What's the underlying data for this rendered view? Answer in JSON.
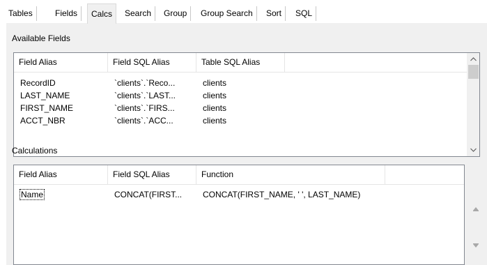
{
  "tabs": [
    {
      "label": "Tables"
    },
    {
      "label": "Fields"
    },
    {
      "label": "Calcs"
    },
    {
      "label": "Search"
    },
    {
      "label": "Group"
    },
    {
      "label": "Group Search"
    },
    {
      "label": "Sort"
    },
    {
      "label": "SQL"
    }
  ],
  "active_tab": "Calcs",
  "available_fields": {
    "label": "Available Fields",
    "columns": [
      "Field Alias",
      "Field SQL Alias",
      "Table SQL Alias"
    ],
    "rows": [
      [
        "RecordID",
        "`clients`.`Reco...",
        "clients"
      ],
      [
        "LAST_NAME",
        "`clients`.`LAST...",
        "clients"
      ],
      [
        "FIRST_NAME",
        "`clients`.`FIRS...",
        "clients"
      ],
      [
        "ACCT_NBR",
        "`clients`.`ACC...",
        "clients"
      ]
    ]
  },
  "calculations": {
    "label": "Calculations",
    "columns": [
      "Field Alias",
      "Field SQL Alias",
      "Function"
    ],
    "rows": [
      [
        "Name",
        "CONCAT(FIRST...",
        "CONCAT(FIRST_NAME, ' ', LAST_NAME)"
      ]
    ]
  },
  "icons": {
    "scroll_up": "chevron-up-icon",
    "scroll_down": "chevron-down-icon",
    "move_up": "move-up-icon",
    "move_down": "move-down-icon"
  }
}
